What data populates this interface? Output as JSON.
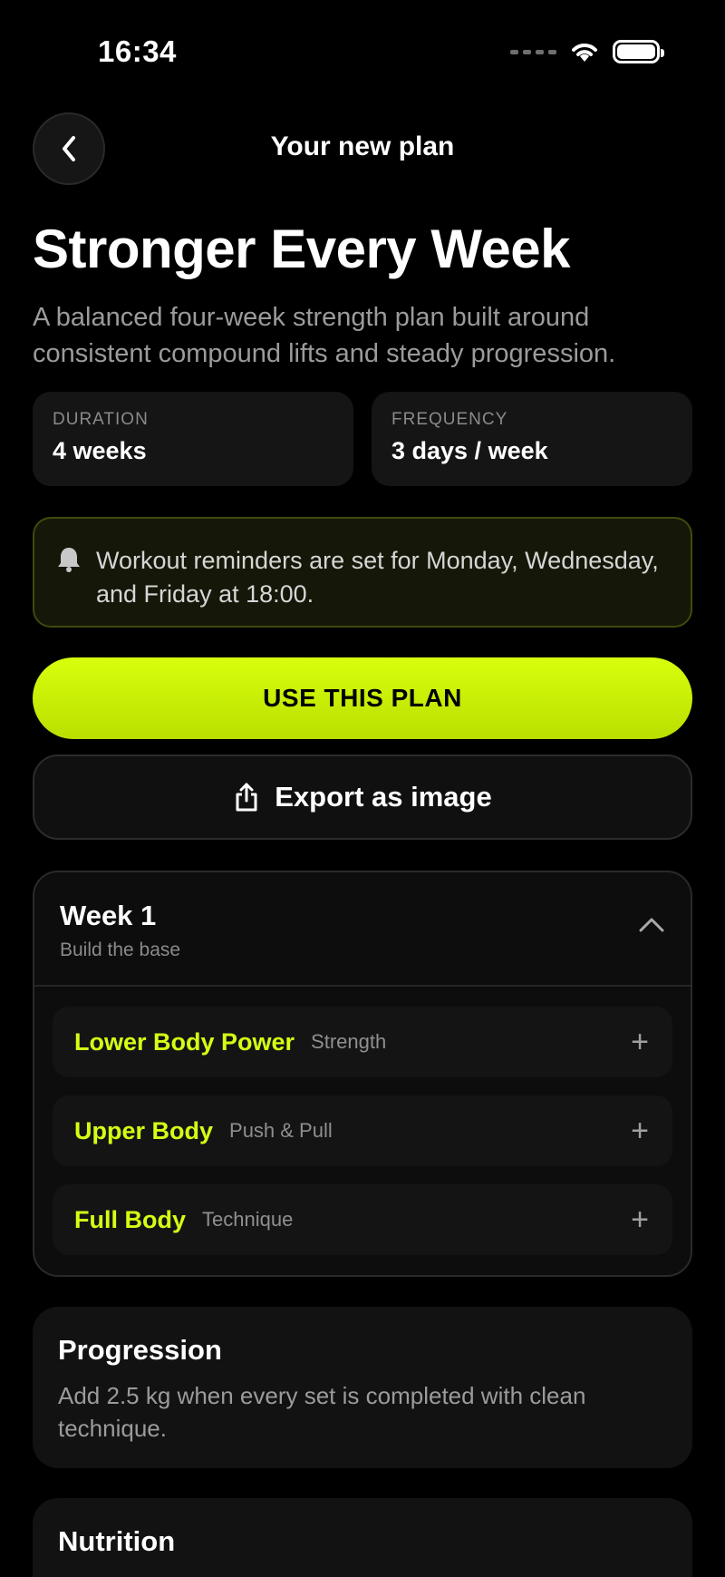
{
  "status_bar": {
    "time": "16:34"
  },
  "header": {
    "title": "Your new plan"
  },
  "plan": {
    "title": "Stronger Every Week",
    "description": "A balanced four-week strength plan built around consistent compound lifts and steady progression."
  },
  "stats": [
    {
      "label": "DURATION",
      "value": "4 weeks"
    },
    {
      "label": "FREQUENCY",
      "value": "3 days / week"
    }
  ],
  "reminder": {
    "text": "Workout reminders are set for Monday, Wednesday, and Friday at 18:00."
  },
  "actions": {
    "primary_label": "USE THIS PLAN",
    "export_label": "Export as image"
  },
  "week": {
    "title": "Week 1",
    "subtitle": "Build the base",
    "workouts": [
      {
        "name": "Lower Body Power",
        "tag": "Strength"
      },
      {
        "name": "Upper Body",
        "tag": "Push & Pull"
      },
      {
        "name": "Full Body",
        "tag": "Technique"
      }
    ]
  },
  "progression": {
    "title": "Progression",
    "body": "Add 2.5 kg when every set is completed with clean technique."
  },
  "nutrition": {
    "title": "Nutrition"
  },
  "colors": {
    "accent": "#d4ff14",
    "background": "#000000",
    "card": "#121212"
  }
}
